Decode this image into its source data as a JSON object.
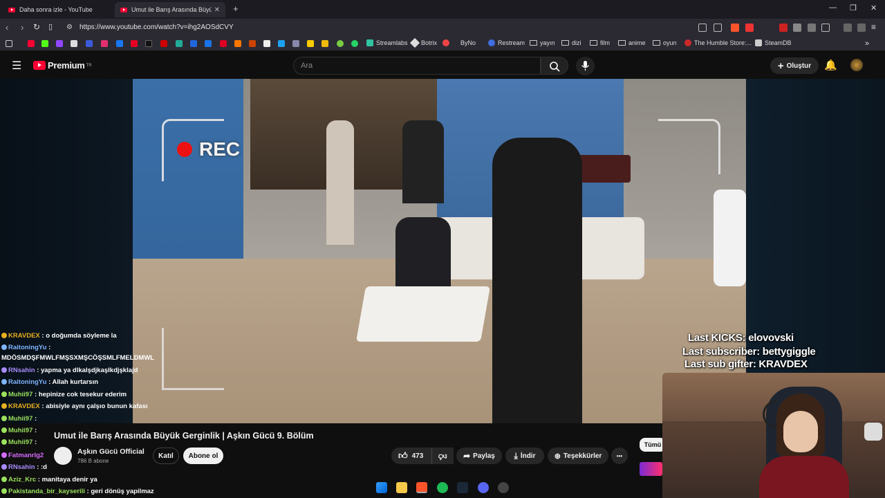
{
  "tabs": [
    {
      "label": "Daha sonra izle - YouTube"
    },
    {
      "label": "Umut ile Barış Arasında Büyük G"
    }
  ],
  "browser": {
    "url": "https://www.youtube.com/watch?v=ihg2AOSdCVY",
    "new_tab": "+",
    "win_min": "—",
    "win_max": "❐",
    "win_close": "✕"
  },
  "bookmarks": [
    {
      "label": "Streamlabs"
    },
    {
      "label": "Botrix"
    },
    {
      "label": "ByNo"
    },
    {
      "label": "Restream"
    },
    {
      "label": "yayın"
    },
    {
      "label": "dizi"
    },
    {
      "label": "film"
    },
    {
      "label": "anime"
    },
    {
      "label": "oyun"
    },
    {
      "label": "The Humble Store:..."
    },
    {
      "label": "SteamDB"
    }
  ],
  "youtube": {
    "logo": "Premium",
    "logo_sup": "TR",
    "search_placeholder": "Ara",
    "create_label": "Oluştur"
  },
  "overlay": {
    "rec_label": "REC",
    "last_kicks": "Last KICKS: elovovski",
    "last_subscriber": "Last subscriber: bettygiggle",
    "last_sub_gifter": "Last sub gifter: KRAVDEX"
  },
  "chat": [
    {
      "user": "KRAVDEX",
      "msg": ": o doğumda söyleme la",
      "color": "#e8b020"
    },
    {
      "user": "RaitoningYu",
      "msg": ":",
      "color": "#7fb4ff"
    },
    {
      "user": "",
      "msg": "MDÖSMDŞFMWLFMŞSXMŞCÖŞSMLFMELDMWL",
      "color": "#ffffff"
    },
    {
      "user": "RNsahin",
      "msg": ": yapma ya dlkalşdjkaşlkdjşklajd",
      "color": "#a78bfa"
    },
    {
      "user": "RaitoningYu",
      "msg": ": Allah kurtarsın",
      "color": "#7fb4ff"
    },
    {
      "user": "Muhii97",
      "msg": ": hepinize cok tesekur ederim",
      "color": "#9be15d"
    },
    {
      "user": "KRAVDEX",
      "msg": ": abisiyle aynı çalşıo bunun kafası",
      "color": "#e8b020"
    },
    {
      "user": "Muhii97",
      "msg": ":",
      "color": "#9be15d"
    },
    {
      "user": "Muhii97",
      "msg": ":",
      "color": "#9be15d"
    },
    {
      "user": "Muhii97",
      "msg": ":",
      "color": "#9be15d"
    },
    {
      "user": "Fatmanrlg2",
      "msg": "",
      "color": "#d46bff"
    },
    {
      "user": "RNsahin",
      "msg": ": :d",
      "color": "#a78bfa"
    },
    {
      "user": "Aziz_Krc",
      "msg": ": manitaya denir ya",
      "color": "#9be15d"
    },
    {
      "user": "Pakistanda_bir_kayserili",
      "msg": ": geri dönüş yapilmaz",
      "color": "#9be15d"
    }
  ],
  "video": {
    "title": "Umut ile Barış Arasında Büyük Gerginlik | Aşkın Gücü 9. Bölüm",
    "channel": "Aşkın Gücü Official",
    "subs": "786 B abone",
    "join": "Katıl",
    "subscribe": "Abone ol",
    "likes": "473",
    "share": "Paylaş",
    "download": "İndir",
    "thanks": "Teşekkürler",
    "more": "•••",
    "all_chip": "Tümü"
  }
}
